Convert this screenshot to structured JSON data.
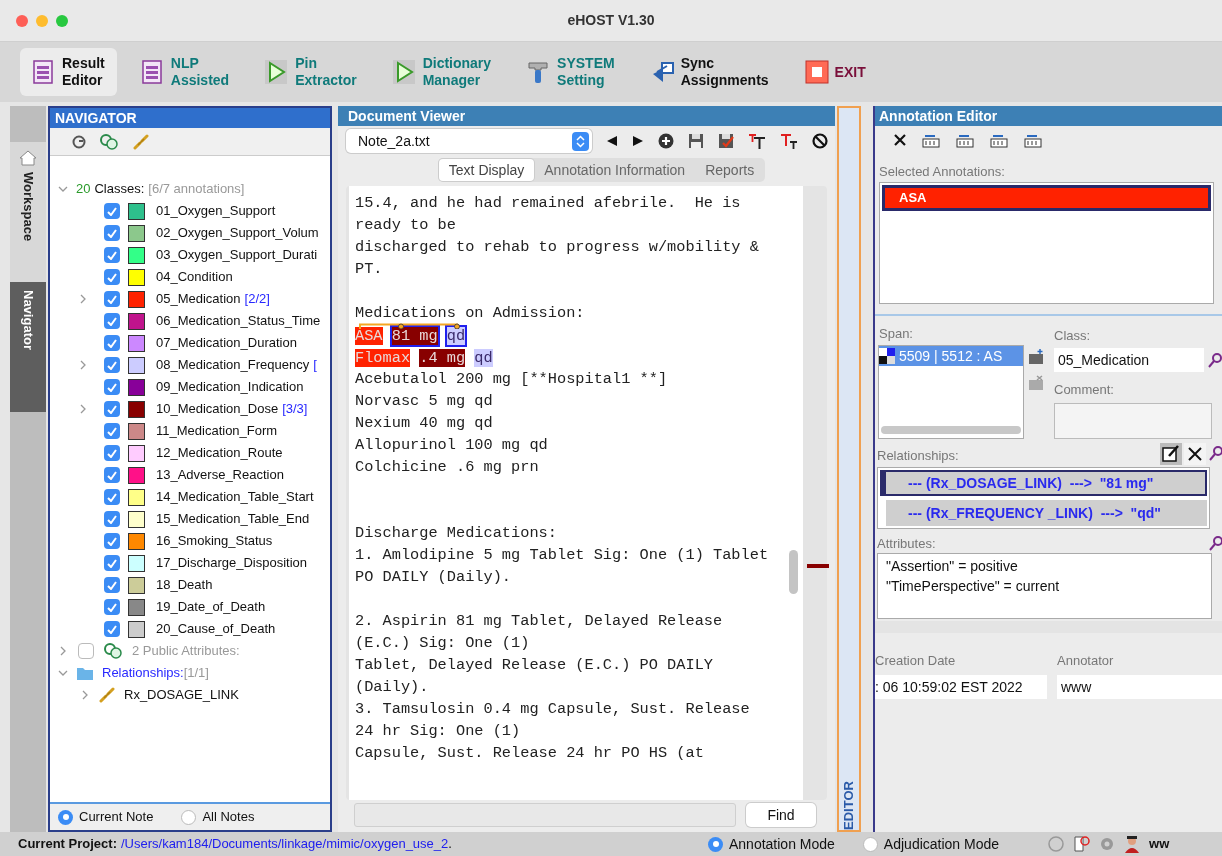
{
  "window": {
    "title": "eHOST V1.30"
  },
  "toolbar": [
    {
      "kind": "document",
      "lines": [
        "Result",
        "Editor"
      ],
      "color": "#111111",
      "selected": true
    },
    {
      "kind": "document",
      "lines": [
        "NLP",
        "Assisted"
      ],
      "color": "#0f7a7a",
      "selected": false
    },
    {
      "kind": "play",
      "lines": [
        "Pin",
        "Extractor"
      ],
      "color": "#0f7a7a",
      "selected": false
    },
    {
      "kind": "play",
      "lines": [
        "Dictionary",
        "Manager"
      ],
      "color": "#0f7a7a",
      "selected": false
    },
    {
      "kind": "tool",
      "lines": [
        "SYSTEM",
        "Setting"
      ],
      "color": "#0f7a7a",
      "selected": false
    },
    {
      "kind": "sync",
      "lines": [
        "Sync",
        "Assignments"
      ],
      "color": "#111111",
      "selected": false
    },
    {
      "kind": "exit",
      "lines": [
        "EXIT"
      ],
      "color": "#7a0f3a",
      "selected": false
    }
  ],
  "side_tabs": [
    {
      "label": "Workspace",
      "selected": false
    },
    {
      "label": "Navigator",
      "selected": true
    }
  ],
  "navigator": {
    "title": "NAVIGATOR",
    "classes_header": {
      "count": "20",
      "label": "Classes:",
      "summary": "[6/7 annotations]",
      "expanded": true
    },
    "classes": [
      {
        "name": "01_Oxygen_Support",
        "color": "#2ec08c",
        "checked": true,
        "expandable": false
      },
      {
        "name": "02_Oxygen_Support_Volum",
        "color": "#8cc88c",
        "checked": true,
        "expandable": false
      },
      {
        "name": "03_Oxygen_Support_Durati",
        "color": "#33ff88",
        "checked": true,
        "expandable": false
      },
      {
        "name": "04_Condition",
        "color": "#ffff00",
        "checked": true,
        "expandable": false
      },
      {
        "name": "05_Medication",
        "count": "[2/2]",
        "color": "#ff2200",
        "checked": true,
        "expandable": true
      },
      {
        "name": "06_Medication_Status_Time",
        "color": "#c0148c",
        "checked": true,
        "expandable": false
      },
      {
        "name": "07_Medication_Duration",
        "color": "#cc88ff",
        "checked": true,
        "expandable": false
      },
      {
        "name": "08_Medication_Frequency",
        "count": "[",
        "color": "#ccccff",
        "checked": true,
        "expandable": true
      },
      {
        "name": "09_Medication_Indication",
        "color": "#880099",
        "checked": true,
        "expandable": false
      },
      {
        "name": "10_Medication_Dose",
        "count": "[3/3]",
        "color": "#880000",
        "checked": true,
        "expandable": true
      },
      {
        "name": "11_Medication_Form",
        "color": "#cc8888",
        "checked": true,
        "expandable": false
      },
      {
        "name": "12_Medication_Route",
        "color": "#ffccff",
        "checked": true,
        "expandable": false
      },
      {
        "name": "13_Adverse_Reaction",
        "color": "#ff1188",
        "checked": true,
        "expandable": false
      },
      {
        "name": "14_Medication_Table_Start",
        "color": "#ffff88",
        "checked": true,
        "expandable": false
      },
      {
        "name": "15_Medication_Table_End",
        "color": "#ffffcc",
        "checked": true,
        "expandable": false
      },
      {
        "name": "16_Smoking_Status",
        "color": "#ff8800",
        "checked": true,
        "expandable": false
      },
      {
        "name": "17_Discharge_Disposition",
        "color": "#ccffff",
        "checked": true,
        "expandable": false
      },
      {
        "name": "18_Death",
        "color": "#cccc99",
        "checked": true,
        "expandable": false
      },
      {
        "name": "19_Date_of_Death",
        "color": "#888888",
        "checked": true,
        "expandable": false
      },
      {
        "name": "20_Cause_of_Death",
        "color": "#cccccc",
        "checked": true,
        "expandable": false
      }
    ],
    "public_attributes": {
      "label": "2 Public Attributes:",
      "checked": false,
      "expanded": false
    },
    "relationships": {
      "label": "Relationships:",
      "summary": "[1/1]",
      "expanded": true,
      "children": [
        {
          "label": "Rx_DOSAGE_LINK",
          "expanded": false
        }
      ]
    },
    "scope": [
      {
        "label": "Current Note",
        "selected": true
      },
      {
        "label": "All Notes",
        "selected": false
      }
    ]
  },
  "document_viewer": {
    "title": "Document Viewer",
    "file": "Note_2a.txt",
    "tabs": [
      {
        "label": "Text Display",
        "selected": true
      },
      {
        "label": "Annotation Information",
        "selected": false
      },
      {
        "label": "Reports",
        "selected": false
      }
    ],
    "lines": [
      {
        "kind": "text",
        "text": "15.4, and he had remained afebrile.  He is"
      },
      {
        "kind": "text",
        "text": "ready to be"
      },
      {
        "kind": "text",
        "text": "discharged to rehab to progress w/mobility &"
      },
      {
        "kind": "text",
        "text": "PT."
      },
      {
        "kind": "blank"
      },
      {
        "kind": "text",
        "text": "Medications on Admission:"
      },
      {
        "kind": "annotated",
        "segments": [
          {
            "text": "ASA",
            "color": "#ff2200",
            "outlined": false
          },
          {
            "text": "81 mg",
            "color": "#880000",
            "outlined": true
          },
          {
            "text": "qd",
            "color": "#ccccff",
            "outlined": true
          }
        ]
      },
      {
        "kind": "annotated",
        "segments": [
          {
            "text": "Flomax",
            "color": "#ff2200",
            "outlined": false
          },
          {
            "text": ".4 mg",
            "color": "#880000",
            "outlined": false
          },
          {
            "text": "qd",
            "color": "#ccccff",
            "outlined": false
          }
        ]
      },
      {
        "kind": "text",
        "text": "Acebutalol 200 mg [**Hospital1 **]"
      },
      {
        "kind": "text",
        "text": "Norvasc 5 mg qd"
      },
      {
        "kind": "text",
        "text": "Nexium 40 mg qd"
      },
      {
        "kind": "text",
        "text": "Allopurinol 100 mg qd"
      },
      {
        "kind": "text",
        "text": "Colchicine .6 mg prn"
      },
      {
        "kind": "blank"
      },
      {
        "kind": "blank"
      },
      {
        "kind": "text",
        "text": "Discharge Medications:"
      },
      {
        "kind": "text",
        "text": "1. Amlodipine 5 mg Tablet Sig: One (1) Tablet"
      },
      {
        "kind": "text",
        "text": "PO DAILY (Daily)."
      },
      {
        "kind": "blank"
      },
      {
        "kind": "text",
        "text": "2. Aspirin 81 mg Tablet, Delayed Release"
      },
      {
        "kind": "text",
        "text": "(E.C.) Sig: One (1)"
      },
      {
        "kind": "text",
        "text": "Tablet, Delayed Release (E.C.) PO DAILY"
      },
      {
        "kind": "text",
        "text": "(Daily)."
      },
      {
        "kind": "text",
        "text": "3. Tamsulosin 0.4 mg Capsule, Sust. Release"
      },
      {
        "kind": "text",
        "text": "24 hr Sig: One (1)"
      },
      {
        "kind": "text",
        "text": "Capsule, Sust. Release 24 hr PO HS (at"
      }
    ],
    "find_button": "Find"
  },
  "editor_tab": {
    "label": "EDITOR"
  },
  "annotation_editor": {
    "title": "Annotation Editor",
    "selected_label": "Selected Annotations:",
    "selected_annotations": [
      {
        "text": "ASA",
        "color": "#ff2200",
        "selected": true
      }
    ],
    "span_label": "Span:",
    "spans": [
      {
        "text": "5509 | 5512 : AS",
        "selected": true
      }
    ],
    "class_label": "Class:",
    "class_value": "05_Medication",
    "comment_label": "Comment:",
    "relationships_label": "Relationships:",
    "relationships": [
      {
        "text": "--- (Rx_DOSAGE_LINK)  --->  \"81 mg\"",
        "selected": true
      },
      {
        "text": "--- (Rx_FREQUENCY _LINK)  --->  \"qd\"",
        "selected": false
      }
    ],
    "attributes_label": "Attributes:",
    "attributes": [
      "\"Assertion\" = positive",
      "\"TimePerspective\" = current"
    ],
    "creation_label": "Creation Date",
    "creation_value": ": 06 10:59:02 EST 2022",
    "annotator_label": "Annotator",
    "annotator_value": "www"
  },
  "status_bar": {
    "project_label": "Current Project:",
    "project_path": "/Users/kam184/Documents/linkage/mimic/oxygen_use_2",
    "project_end": ".",
    "modes": [
      {
        "label": "Annotation Mode",
        "selected": true
      },
      {
        "label": "Adjudication Mode",
        "selected": false
      }
    ],
    "user": "ww"
  }
}
